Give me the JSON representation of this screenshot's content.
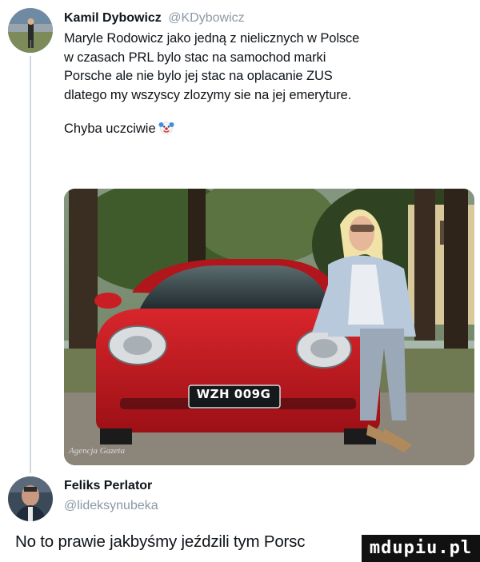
{
  "tweet": {
    "display_name": "Kamil Dybowicz",
    "handle": "@KDybowicz",
    "body": "Maryle Rodowicz jako jedną z nielicznych w Polsce\nw czasach PRL bylo stac na samochod marki\nPorsche ale nie bylo jej stac na oplacanie ZUS\ndlatego my wszyscy zlozymy sie na jej emeryture.",
    "follow_line": "Chyba uczciwie",
    "emoji_icon": "clown-face-icon",
    "photo": {
      "watermark": "Agencja Gazeta",
      "license_plate": "WZH 009G",
      "car_color": "#c41c22"
    }
  },
  "reply": {
    "display_name": "Feliks Perlator",
    "handle": "@lideksynubeka",
    "body": "No to prawie jakbyśmy jeździli tym Porsc"
  },
  "site_logo": "mdupiu.pl",
  "colors": {
    "text": "#0f1419",
    "handle": "#8b98a5",
    "thread_line": "#cfd9de"
  }
}
